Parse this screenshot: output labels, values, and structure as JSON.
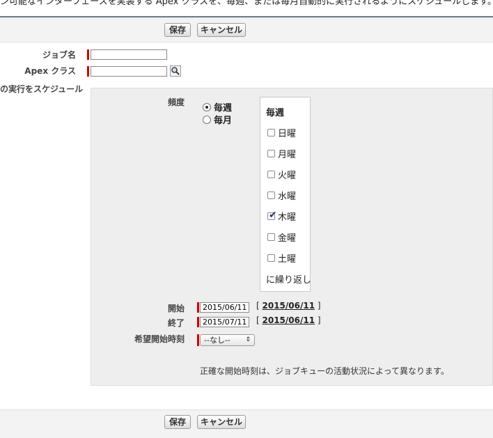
{
  "intro_text": "ン可能なインターフェースを実装する Apex クラスを、毎週、または毎月自動的に実行されるようにスケジュールします。",
  "buttons": {
    "save": "保存",
    "cancel": "キャンセル"
  },
  "fields": {
    "job_name_label": "ジョブ名",
    "apex_class_label": "Apex クラス",
    "schedule_label": "の実行をスケジュール",
    "lookup_icon": "magnifier-icon"
  },
  "frequency": {
    "label": "頻度",
    "options": [
      "毎週",
      "毎月"
    ],
    "selected": "毎週"
  },
  "weekly": {
    "title": "毎週",
    "days": [
      {
        "label": "日曜",
        "checked": false
      },
      {
        "label": "月曜",
        "checked": false
      },
      {
        "label": "火曜",
        "checked": false
      },
      {
        "label": "水曜",
        "checked": false
      },
      {
        "label": "木曜",
        "checked": true
      },
      {
        "label": "金曜",
        "checked": false
      },
      {
        "label": "土曜",
        "checked": false
      }
    ],
    "repeat_label": "に繰り返し"
  },
  "start": {
    "label": "開始",
    "value": "2015/06/11",
    "link": "2015/06/11"
  },
  "end": {
    "label": "終了",
    "value": "2015/07/11",
    "link": "2015/06/11"
  },
  "preferred_time": {
    "label": "希望開始時刻",
    "value": "--なし--"
  },
  "note": "正確な開始時刻は、ジョブキューの活動状況によって異なります。",
  "colors": {
    "required": "#cc0000",
    "panel": "#eeeeee",
    "rule": "#6f7e93"
  }
}
